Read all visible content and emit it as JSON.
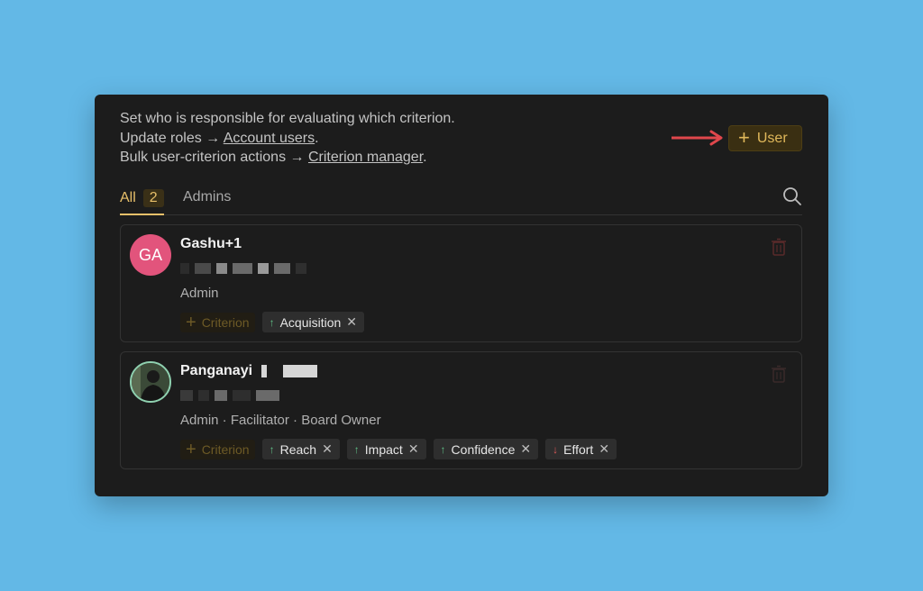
{
  "intro": {
    "line1": "Set who is responsible for evaluating which criterion.",
    "line2_prefix": "Update roles → ",
    "line2_link": "Account users",
    "line2_suffix": ".",
    "line3_prefix": "Bulk user-criterion actions → ",
    "line3_link": "Criterion manager",
    "line3_suffix": "."
  },
  "add_user": {
    "icon": "plus-icon",
    "label": "User"
  },
  "tabs": {
    "all": {
      "label": "All",
      "count": "2"
    },
    "admins": {
      "label": "Admins"
    }
  },
  "users": [
    {
      "initials": "GA",
      "name": "Gashu+1",
      "roles": "Admin",
      "add_criterion_label": "Criterion",
      "criteria": [
        {
          "label": "Acquisition",
          "direction": "up"
        }
      ]
    },
    {
      "initials": "",
      "name": "Panganayi",
      "roles": "Admin · Facilitator · Board Owner",
      "add_criterion_label": "Criterion",
      "criteria": [
        {
          "label": "Reach",
          "direction": "up"
        },
        {
          "label": "Impact",
          "direction": "up"
        },
        {
          "label": "Confidence",
          "direction": "up"
        },
        {
          "label": "Effort",
          "direction": "down"
        }
      ]
    }
  ],
  "colors": {
    "background": "#63b8e6",
    "panel": "#1c1c1c",
    "accent": "#e8c06a",
    "up": "#5fbf86",
    "down": "#e05a5a",
    "arrow": "#e0474c"
  }
}
